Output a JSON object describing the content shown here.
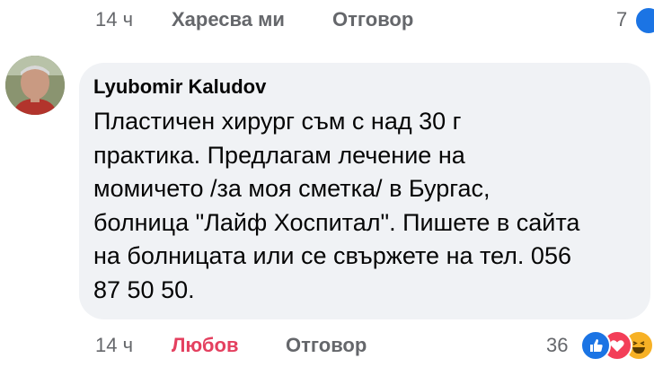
{
  "previous_comment_actions": {
    "time": "14 ч",
    "like_label": "Харесва ми",
    "reply_label": "Отговор",
    "reaction_count": "7"
  },
  "comment": {
    "author": "Lyubomir Kaludov",
    "text_lines": [
      "Пластичен хирург съм с над 30 г",
      "практика. Предлагам лечение на",
      "момичето /за моя сметка/ в Бургас,",
      "болница \"Лайф Хоспитал\". Пишете в сайта",
      "на болницата или се свържете на тел. 056",
      "87 50 50."
    ]
  },
  "comment_actions": {
    "time": "14 ч",
    "reaction_label": "Любов",
    "reply_label": "Отговор",
    "reaction_count": "36",
    "reaction_icons": [
      "like-icon",
      "love-icon",
      "haha-icon"
    ]
  },
  "colors": {
    "bubble": "#f0f2f5",
    "meta_text": "#65676b",
    "love_accent": "#e4405f",
    "like_blue": "#1b74e4"
  }
}
